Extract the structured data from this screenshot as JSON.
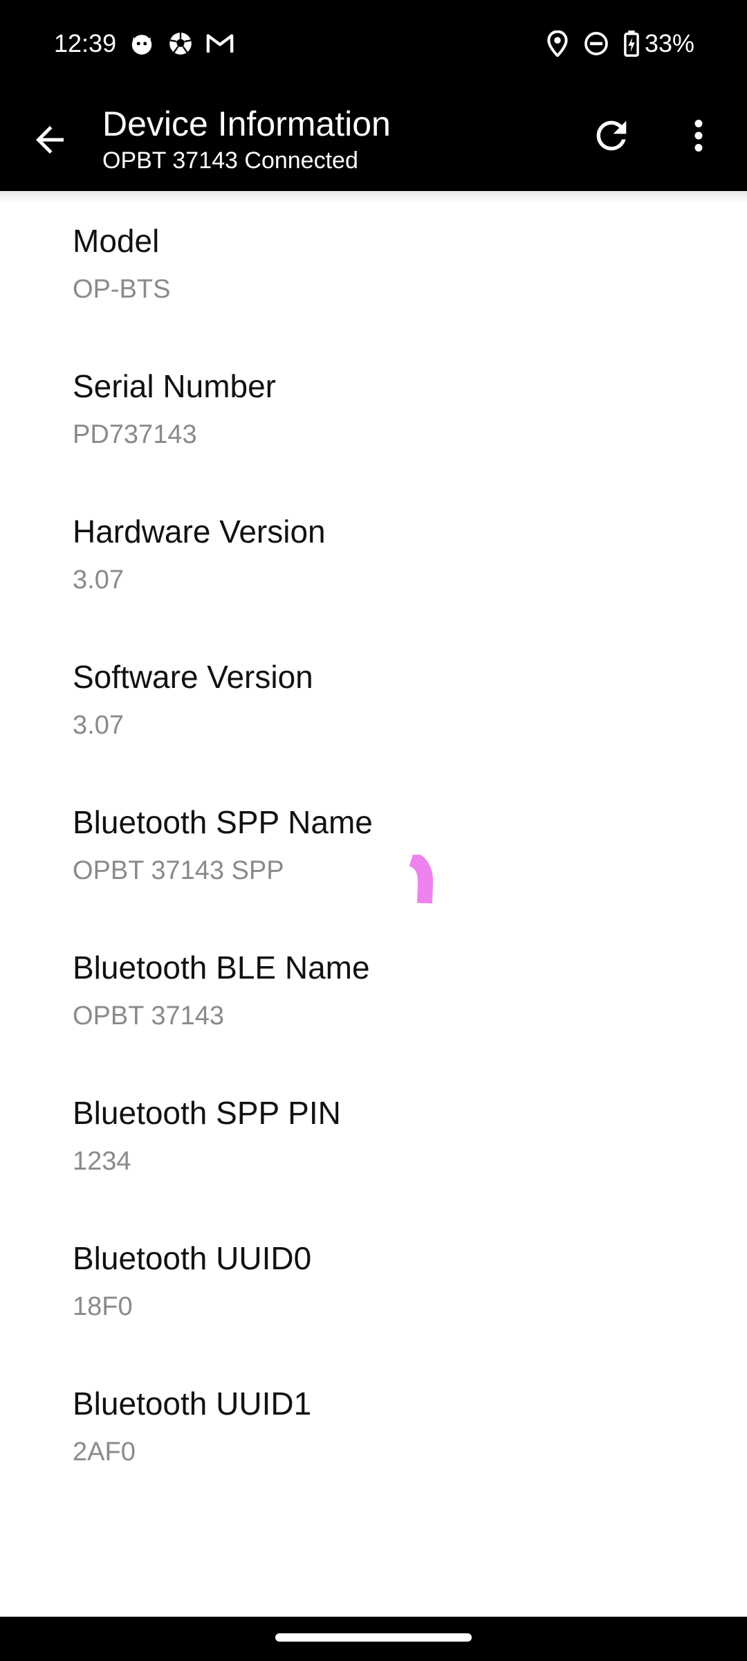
{
  "status_bar": {
    "time": "12:39",
    "battery": "33%",
    "left_icons": [
      "cat-face-icon",
      "soccer-ball-icon",
      "gmail-icon"
    ],
    "right_icons": [
      "location-pin-icon",
      "do-not-disturb-icon",
      "battery-charging-icon"
    ]
  },
  "app_bar": {
    "title": "Device Information",
    "subtitle": "OPBT 37143 Connected"
  },
  "items": [
    {
      "title": "Model",
      "value": "OP-BTS"
    },
    {
      "title": "Serial Number",
      "value": "PD737143"
    },
    {
      "title": "Hardware Version",
      "value": "3.07"
    },
    {
      "title": "Software Version",
      "value": "3.07"
    },
    {
      "title": "Bluetooth SPP Name",
      "value": "OPBT 37143 SPP"
    },
    {
      "title": "Bluetooth BLE Name",
      "value": "OPBT 37143"
    },
    {
      "title": "Bluetooth SPP PIN",
      "value": "1234"
    },
    {
      "title": "Bluetooth UUID0",
      "value": "18F0"
    },
    {
      "title": "Bluetooth UUID1",
      "value": "2AF0"
    }
  ],
  "colors": {
    "app_bar": "#000000",
    "title_text": "#111111",
    "value_text": "#8a8a8a",
    "spinner": "#ee82ee"
  }
}
